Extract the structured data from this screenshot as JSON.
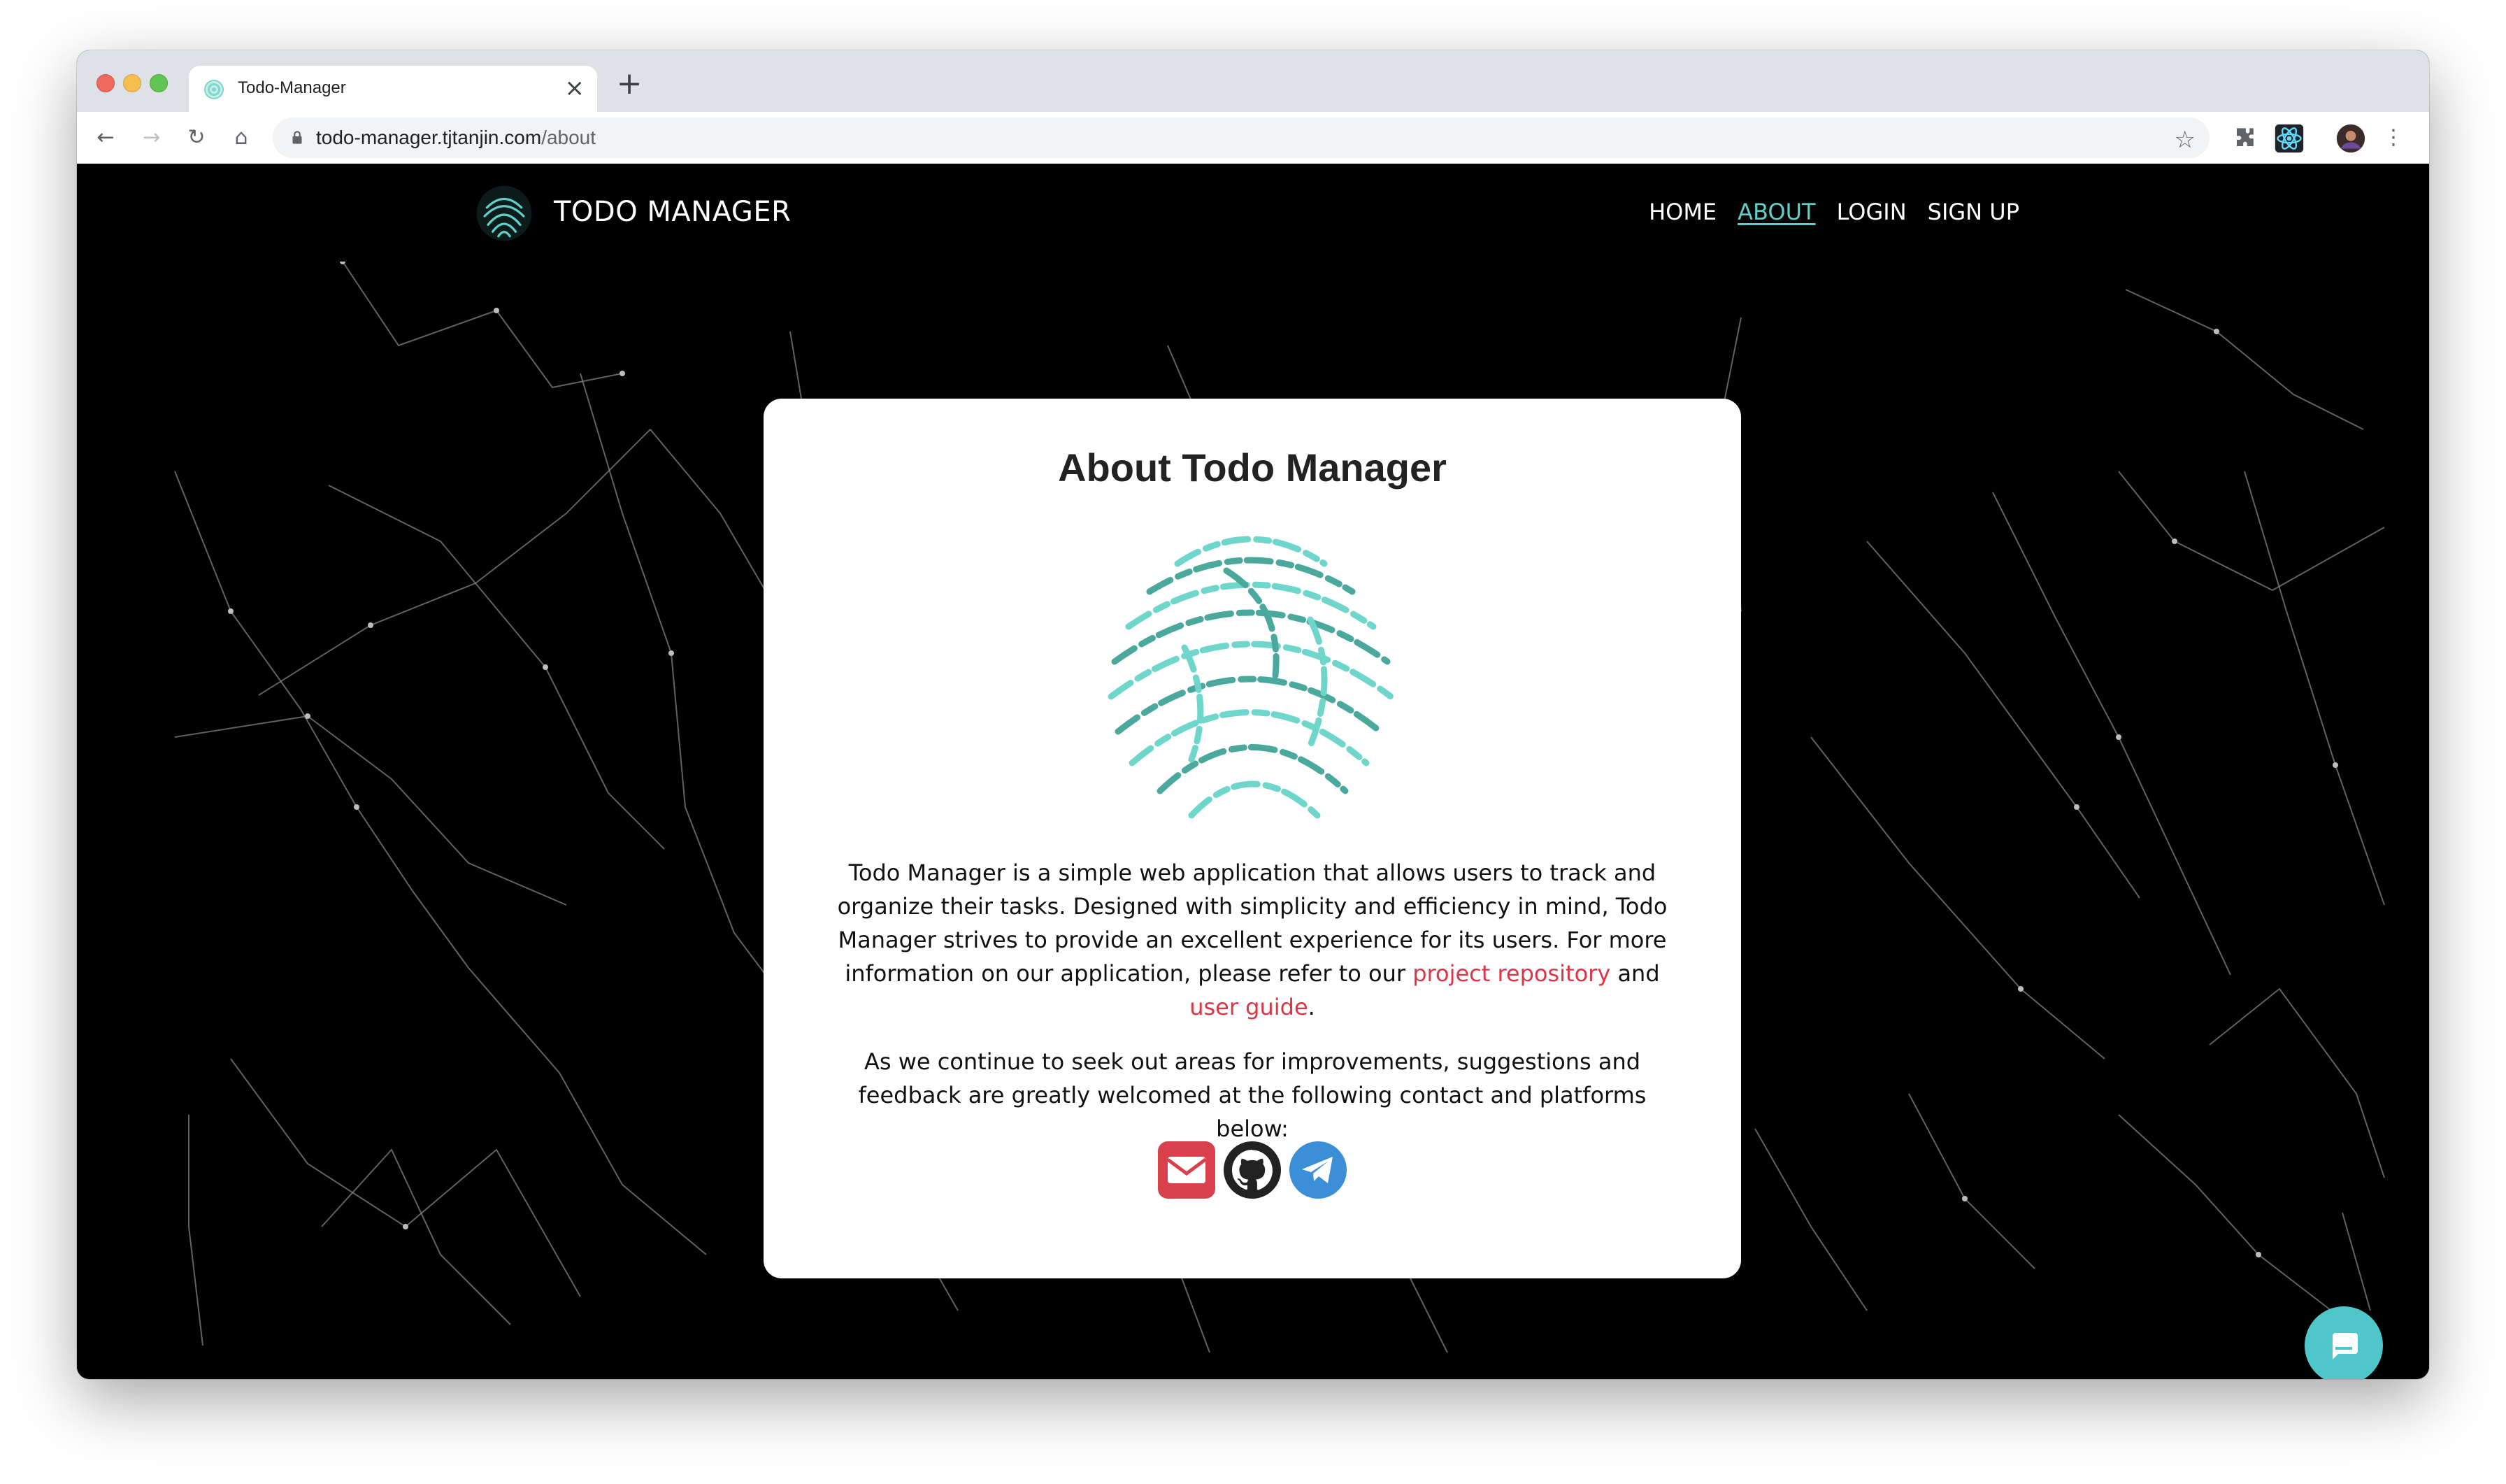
{
  "browser": {
    "tab_title": "Todo-Manager",
    "tab_close": "×",
    "new_tab": "+",
    "url_host": "todo-manager.tjtanjin.com",
    "url_path": "/about",
    "back": "←",
    "forward": "→",
    "reload": "↻",
    "home": "⌂",
    "star": "☆",
    "menu": "⋮"
  },
  "navbar": {
    "brand": "TODO MANAGER",
    "links": [
      "HOME",
      "ABOUT",
      "LOGIN",
      "SIGN UP"
    ],
    "active": "ABOUT"
  },
  "card": {
    "title": "About Todo Manager",
    "para1_a": "Todo Manager is a simple web application that allows users to track and organize their tasks. Designed with simplicity and efficiency in mind, Todo Manager strives to provide an excellent experience for its users. For more information on our application, please refer to our ",
    "link_repo": "project repository",
    "para1_and": " and ",
    "link_guide": "user guide",
    "para1_end": ".",
    "para2": "As we continue to seek out areas for improvements, suggestions and feedback are greatly welcomed at the following contact and platforms below:",
    "socials": [
      "email-icon",
      "github-icon",
      "telegram-icon"
    ]
  },
  "colors": {
    "accent": "#5fd0c8",
    "link": "#dc3545",
    "email": "#d9404b",
    "github": "#222222",
    "telegram": "#3a8fd6",
    "chat": "#4fc7ca"
  }
}
